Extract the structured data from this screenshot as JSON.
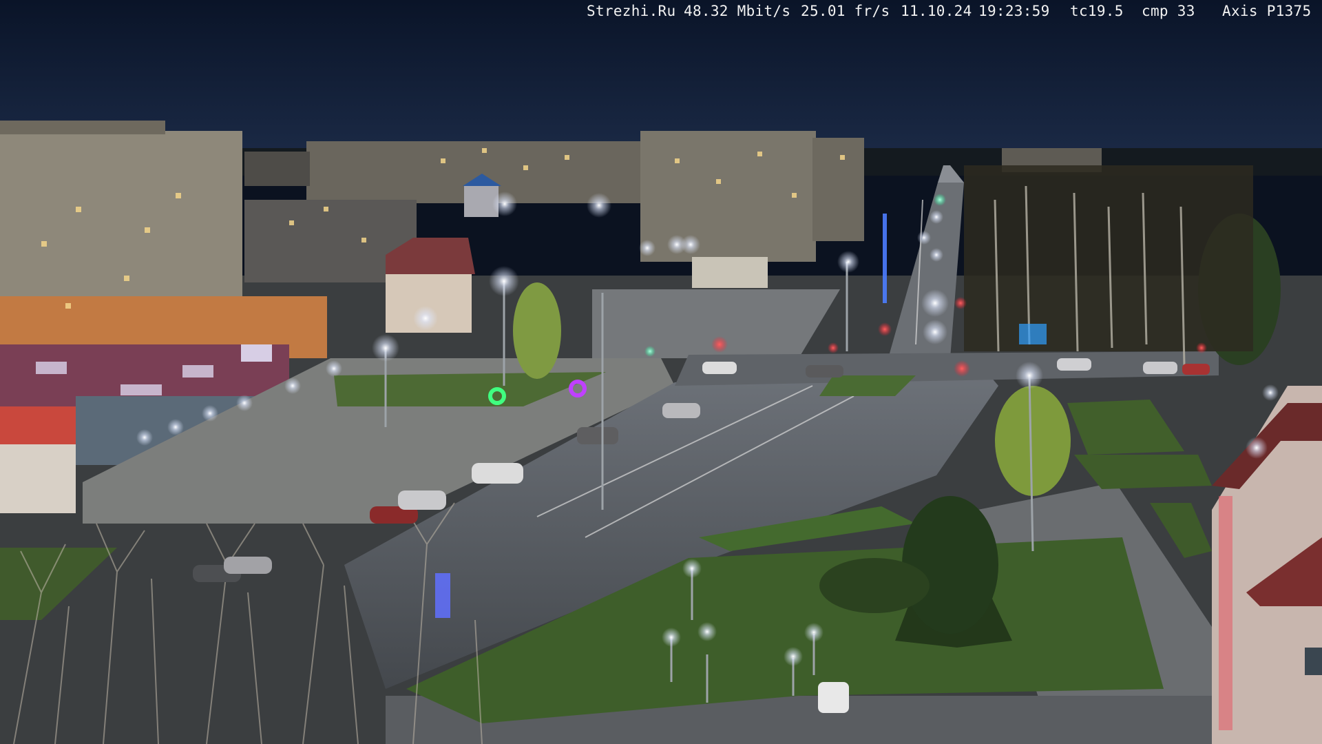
{
  "overlay": {
    "site": "Strezhi.Ru",
    "bitrate": "48.32 Mbit/s",
    "framerate": "25.01 fr/s",
    "date": "11.10.24",
    "time": "19:23:59",
    "tc": "tc19.5",
    "cmp": "cmp 33",
    "camera": "Axis P1375"
  },
  "colors": {
    "sky": "#0d1a33",
    "road": "#55595f",
    "grass": "#3c5a28",
    "lamp": "#ffffff",
    "signal_red": "#ff2030",
    "signal_green": "#20ffa0"
  }
}
